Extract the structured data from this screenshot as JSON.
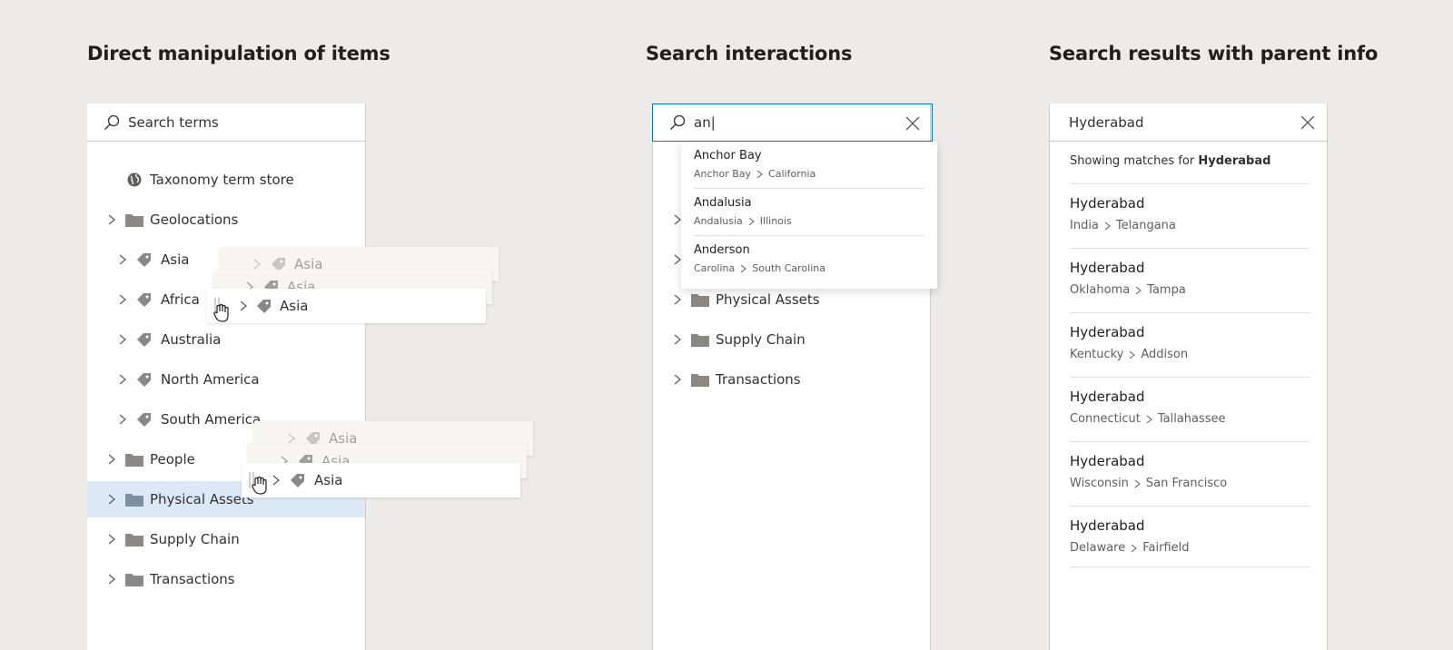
{
  "sections": {
    "direct_title": "Direct manipulation of items",
    "search_title": "Search interactions",
    "results_title": "Search results with parent info"
  },
  "panel1": {
    "search_placeholder": "Search terms",
    "root": "Taxonomy term store",
    "groups": {
      "geolocations": "Geolocations",
      "asia": "Asia",
      "africa": "Africa",
      "australia": "Australia",
      "north_america": "North America",
      "south_america": "South America",
      "people": "People",
      "physical_assets": "Physical Assets",
      "supply_chain": "Supply Chain",
      "transactions": "Transactions"
    },
    "drag_ghost_label": "Asia"
  },
  "panel2": {
    "search_value": "an|",
    "tree": {
      "physical_assets": "Physical Assets",
      "supply_chain": "Supply Chain",
      "transactions": "Transactions"
    },
    "suggestions": [
      {
        "title": "Anchor Bay",
        "path": [
          "Anchor Bay",
          "California"
        ]
      },
      {
        "title": "Andalusia",
        "path": [
          "Andalusia",
          "Illinois"
        ]
      },
      {
        "title": "Anderson",
        "path": [
          "Carolina",
          "South Carolina"
        ]
      }
    ]
  },
  "panel3": {
    "search_value": "Hyderabad",
    "matches_prefix": "Showing matches for",
    "matches_term": "Hyderabad",
    "results": [
      {
        "title": "Hyderabad",
        "path": [
          "India",
          "Telangana"
        ]
      },
      {
        "title": "Hyderabad",
        "path": [
          "Oklahoma",
          "Tampa"
        ]
      },
      {
        "title": "Hyderabad",
        "path": [
          "Kentucky",
          "Addison"
        ]
      },
      {
        "title": "Hyderabad",
        "path": [
          "Connecticut",
          "Tallahassee"
        ]
      },
      {
        "title": "Hyderabad",
        "path": [
          "Wisconsin",
          "San Francisco"
        ]
      },
      {
        "title": "Hyderabad",
        "path": [
          "Delaware",
          "Fairfield"
        ]
      }
    ]
  },
  "colors": {
    "accent": "#0078d4",
    "selected_row": "#dbe9f6",
    "icon_gray": "#8a8886"
  }
}
